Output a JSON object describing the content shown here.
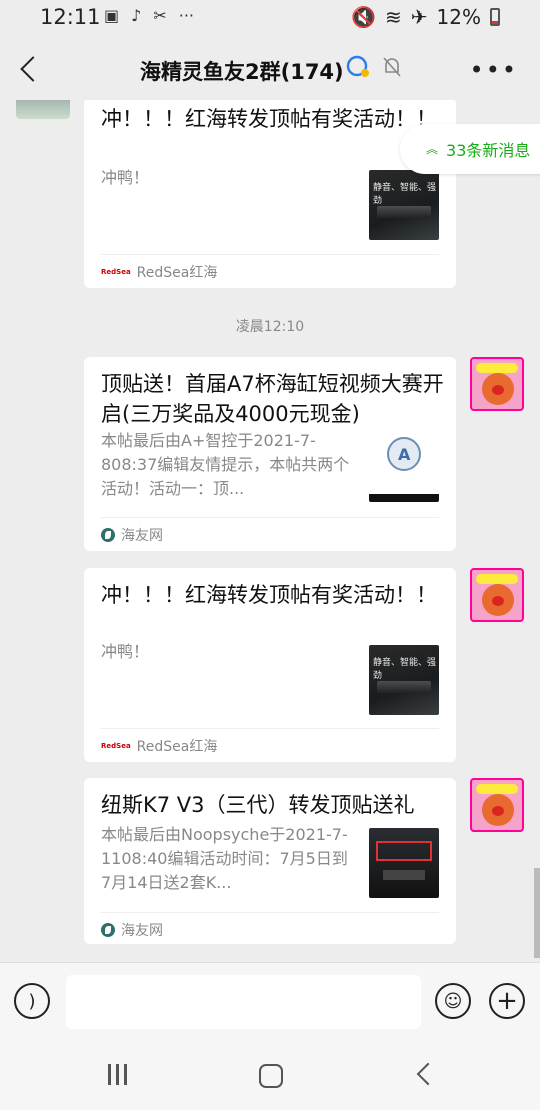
{
  "status": {
    "time": "12:11",
    "battery": "12%"
  },
  "header": {
    "title": "海精灵鱼友2群(174)"
  },
  "new_messages": {
    "label": "33条新消息"
  },
  "messages": [
    {
      "title": "冲！！！红海转发顶帖有奖活动！！",
      "desc": "冲鸭！",
      "thumb_text": "静音、智能、强劲",
      "source": "RedSea红海",
      "source_logo": "RedSea"
    },
    {
      "title": "顶贴送！首届A7杯海缸短视频大赛开启(三万奖品及4000元现金)",
      "desc": "本帖最后由A+智控于2021-7-808:37编辑友情提示，本帖共两个活动！活动一：顶...",
      "source": "海友网"
    },
    {
      "title": "冲！！！红海转发顶帖有奖活动！！",
      "desc": "冲鸭！",
      "thumb_text": "静音、智能、强劲",
      "source": "RedSea红海",
      "source_logo": "RedSea"
    },
    {
      "title": "纽斯K7 V3（三代）转发顶贴送礼",
      "desc": "本帖最后由Noopsyche于2021-7-1108:40编辑活动时间：7月5日到7月14日送2套K...",
      "source": "海友网"
    }
  ],
  "timestamp": "凌晨12:10"
}
